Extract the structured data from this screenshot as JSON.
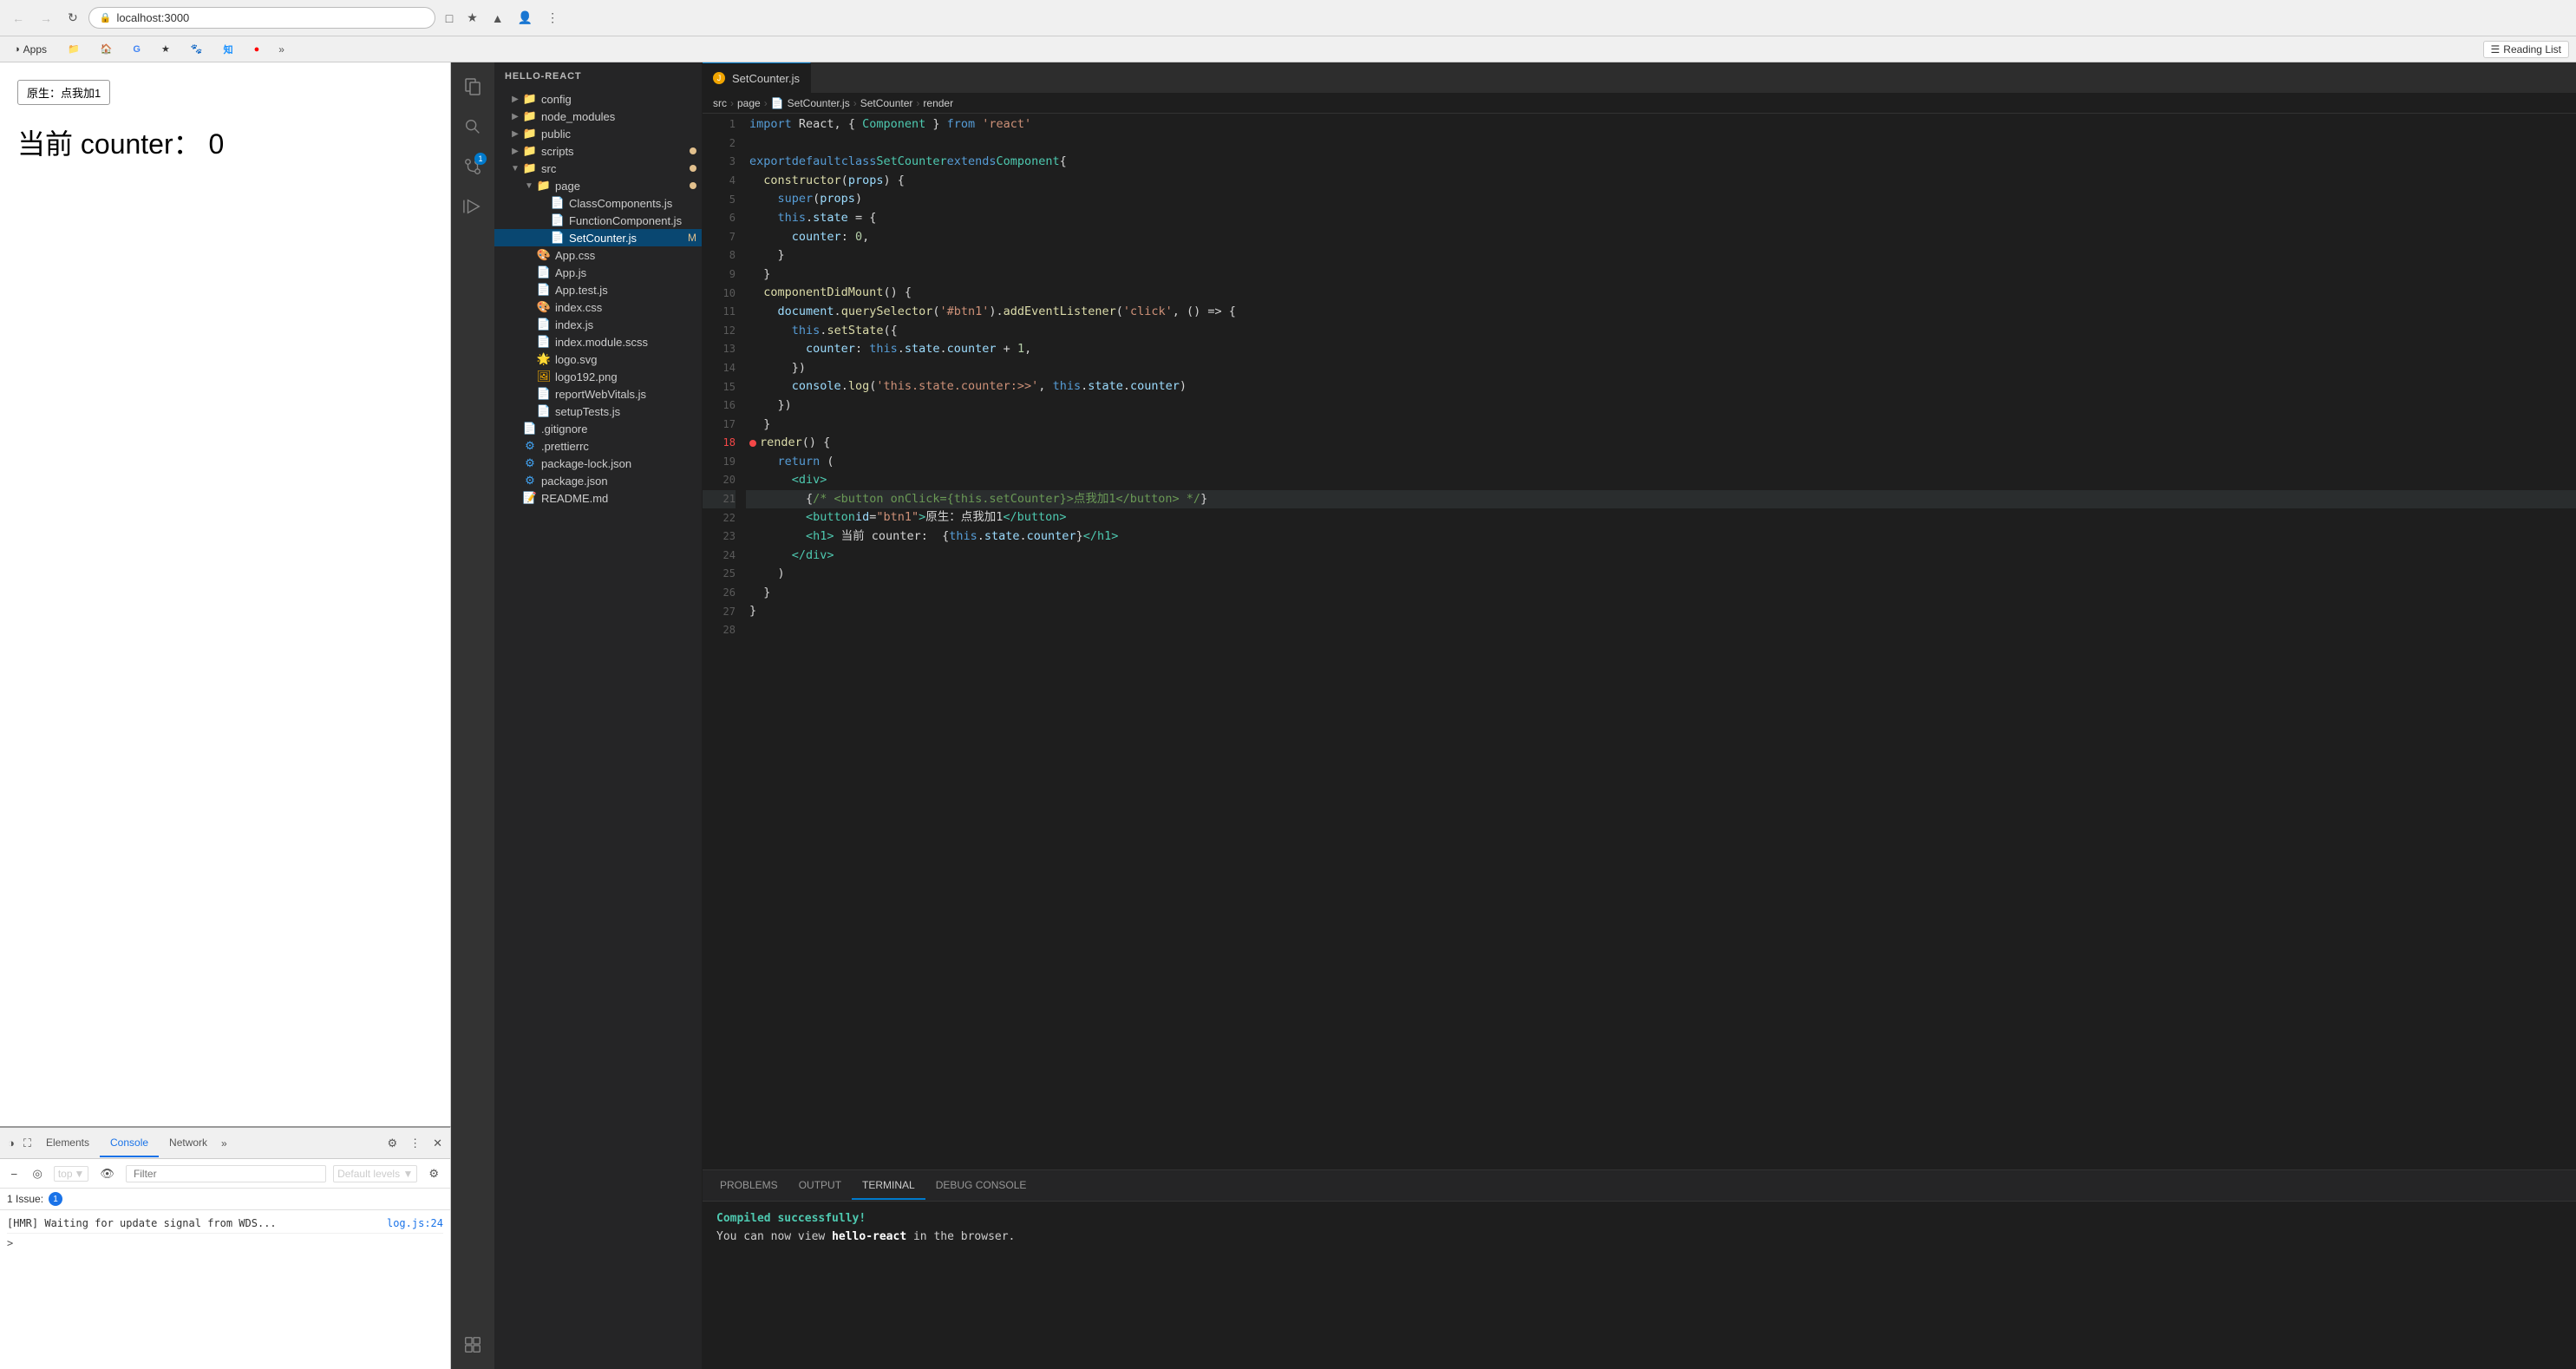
{
  "browser": {
    "url": "localhost:3000",
    "back_btn": "←",
    "forward_btn": "→",
    "reload_btn": "↻",
    "reading_list": "Reading List",
    "bookmarks": [
      {
        "label": "Apps",
        "icon": "🔲"
      },
      {
        "label": "",
        "icon": "📁"
      },
      {
        "label": "",
        "icon": "🏠"
      },
      {
        "label": "",
        "icon": "G"
      },
      {
        "label": "",
        "icon": "★"
      },
      {
        "label": "",
        "icon": "🐾"
      },
      {
        "label": "",
        "icon": "知"
      },
      {
        "label": "",
        "icon": "🔴"
      }
    ]
  },
  "page": {
    "btn_label": "原生：点我加1",
    "heading": "当前 counter：  0"
  },
  "devtools": {
    "tabs": [
      "Elements",
      "Console",
      "Network"
    ],
    "active_tab": "Console",
    "level_label": "Default levels",
    "filter_placeholder": "Filter",
    "top_label": "top",
    "issues_count": "1",
    "issue_label": "1 Issue:",
    "issue_badge": "1",
    "log_message": "[HMR] Waiting for update signal from WDS...",
    "log_link": "log.js:24"
  },
  "vscode": {
    "breadcrumb": {
      "src": "src",
      "page": "page",
      "file": "SetCounter.js",
      "member": "SetCounter",
      "method": "render"
    },
    "explorer": {
      "root": "HELLO-REACT",
      "items": [
        {
          "name": "config",
          "type": "folder",
          "indent": 1,
          "expanded": false
        },
        {
          "name": "node_modules",
          "type": "folder",
          "indent": 1,
          "expanded": false
        },
        {
          "name": "public",
          "type": "folder",
          "indent": 1,
          "expanded": false
        },
        {
          "name": "scripts",
          "type": "folder",
          "indent": 1,
          "expanded": false
        },
        {
          "name": "src",
          "type": "folder",
          "indent": 1,
          "expanded": true,
          "modified": true
        },
        {
          "name": "page",
          "type": "folder",
          "indent": 2,
          "expanded": true,
          "modified": true
        },
        {
          "name": "ClassComponents.js",
          "type": "js",
          "indent": 3
        },
        {
          "name": "FunctionComponent.js",
          "type": "js",
          "indent": 3
        },
        {
          "name": "SetCounter.js",
          "type": "js",
          "indent": 3,
          "active": true,
          "modified_m": true
        },
        {
          "name": "App.css",
          "type": "css",
          "indent": 2
        },
        {
          "name": "App.js",
          "type": "js",
          "indent": 2
        },
        {
          "name": "App.test.js",
          "type": "js",
          "indent": 2
        },
        {
          "name": "index.css",
          "type": "css",
          "indent": 2
        },
        {
          "name": "index.js",
          "type": "js",
          "indent": 2
        },
        {
          "name": "index.module.scss",
          "type": "scss",
          "indent": 2
        },
        {
          "name": "logo.svg",
          "type": "svg",
          "indent": 2
        },
        {
          "name": "logo192.png",
          "type": "png",
          "indent": 2
        },
        {
          "name": "reportWebVitals.js",
          "type": "js",
          "indent": 2
        },
        {
          "name": "setupTests.js",
          "type": "js",
          "indent": 2
        },
        {
          "name": ".gitignore",
          "type": "git",
          "indent": 1
        },
        {
          "name": ".prettierrc",
          "type": "config",
          "indent": 1
        },
        {
          "name": "package-lock.json",
          "type": "json",
          "indent": 1
        },
        {
          "name": "package.json",
          "type": "json",
          "indent": 1
        },
        {
          "name": "README.md",
          "type": "md",
          "indent": 1
        }
      ]
    },
    "tab": "SetCounter.js",
    "terminal": {
      "tabs": [
        "PROBLEMS",
        "OUTPUT",
        "TERMINAL",
        "DEBUG CONSOLE"
      ],
      "active_tab": "TERMINAL",
      "compiled_msg": "Compiled successfully!",
      "run_msg": "You can now view",
      "run_app": "hello-react",
      "run_msg2": "in the browser."
    }
  }
}
